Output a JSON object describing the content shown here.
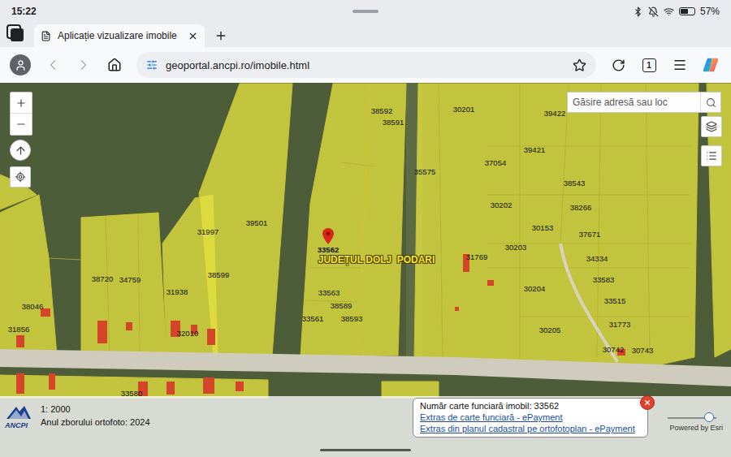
{
  "status_bar": {
    "time": "15:22",
    "battery": "57%",
    "battery_level": 0.57
  },
  "tabs": [
    {
      "label": "Aplicație vizualizare imobile",
      "selected": true
    }
  ],
  "address_bar": {
    "url": "geoportal.ancpi.ro/imobile.html",
    "tab_count": "1",
    "back_enabled": false,
    "forward_enabled": false
  },
  "map": {
    "search": {
      "placeholder": "Găsire adresă sau loc"
    },
    "region_labels": [
      "JUDEȚUL DOLJ",
      "PODARI"
    ],
    "parcels": [
      {
        "label": "38592",
        "selected": false
      },
      {
        "label": "38591",
        "selected": false
      },
      {
        "label": "30201",
        "selected": false
      },
      {
        "label": "39422",
        "selected": false
      },
      {
        "label": "39421",
        "selected": false
      },
      {
        "label": "37054",
        "selected": false
      },
      {
        "label": "35575",
        "selected": false
      },
      {
        "label": "38543",
        "selected": false
      },
      {
        "label": "30202",
        "selected": false
      },
      {
        "label": "38266",
        "selected": false
      },
      {
        "label": "39501",
        "selected": false
      },
      {
        "label": "30153",
        "selected": false
      },
      {
        "label": "31997",
        "selected": false
      },
      {
        "label": "37671",
        "selected": false
      },
      {
        "label": "30203",
        "selected": false
      },
      {
        "label": "33562",
        "selected": true
      },
      {
        "label": "31769",
        "selected": false
      },
      {
        "label": "34334",
        "selected": false
      },
      {
        "label": "38720",
        "selected": false
      },
      {
        "label": "34759",
        "selected": false
      },
      {
        "label": "38599",
        "selected": false
      },
      {
        "label": "33583",
        "selected": false
      },
      {
        "label": "30204",
        "selected": false
      },
      {
        "label": "31938",
        "selected": false
      },
      {
        "label": "33563",
        "selected": false
      },
      {
        "label": "33515",
        "selected": false
      },
      {
        "label": "38589",
        "selected": false
      },
      {
        "label": "38046",
        "selected": false
      },
      {
        "label": "33561",
        "selected": false
      },
      {
        "label": "38593",
        "selected": false
      },
      {
        "label": "31773",
        "selected": false
      },
      {
        "label": "31856",
        "selected": false
      },
      {
        "label": "30205",
        "selected": false
      },
      {
        "label": "32010",
        "selected": false
      },
      {
        "label": "30742",
        "selected": false
      },
      {
        "label": "30743",
        "selected": false
      },
      {
        "label": "33580",
        "selected": false
      }
    ],
    "logo": "ANCPI",
    "scale": "1: 2000",
    "ortho_year": "Anul zborului ortofoto: 2024"
  },
  "popup": {
    "title": "Număr carte funciară imobil: 33562",
    "links": [
      "Extras de carte funciară - ePayment",
      "Extras din planul cadastral pe ortofotoplan - ePayment"
    ]
  },
  "opacity_slider": {
    "level": 0.85
  },
  "attribution": "Powered by Esri"
}
